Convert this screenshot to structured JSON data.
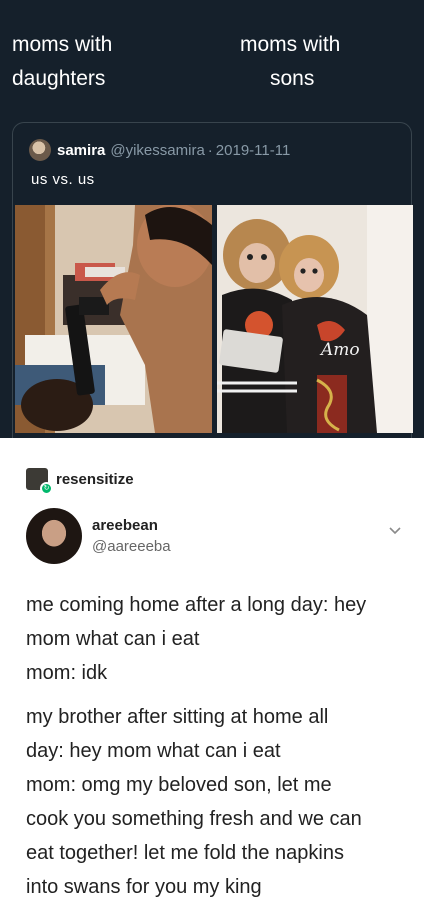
{
  "meme": {
    "caption_left_line1": "moms with",
    "caption_left_line2": "daughters",
    "caption_right_line1": "moms with",
    "caption_right_line2": "sons"
  },
  "tweet": {
    "name": "samira",
    "handle": "@yikessamira",
    "separator": "·",
    "date": "2019-11-11",
    "text": "us vs. us",
    "right_image_caption": "Amo"
  },
  "reblog": {
    "username": "resensitize"
  },
  "post": {
    "name": "areebean",
    "handle": "@aareeeba",
    "lines": [
      "me coming home after a long day: hey",
      "mom what can i eat",
      "mom: idk",
      "my brother after sitting at home all",
      "day: hey mom what can i eat",
      "mom: omg my beloved son, let me",
      "cook you something fresh and we can",
      "eat together! let me fold the napkins",
      "into swans for you my king"
    ]
  }
}
